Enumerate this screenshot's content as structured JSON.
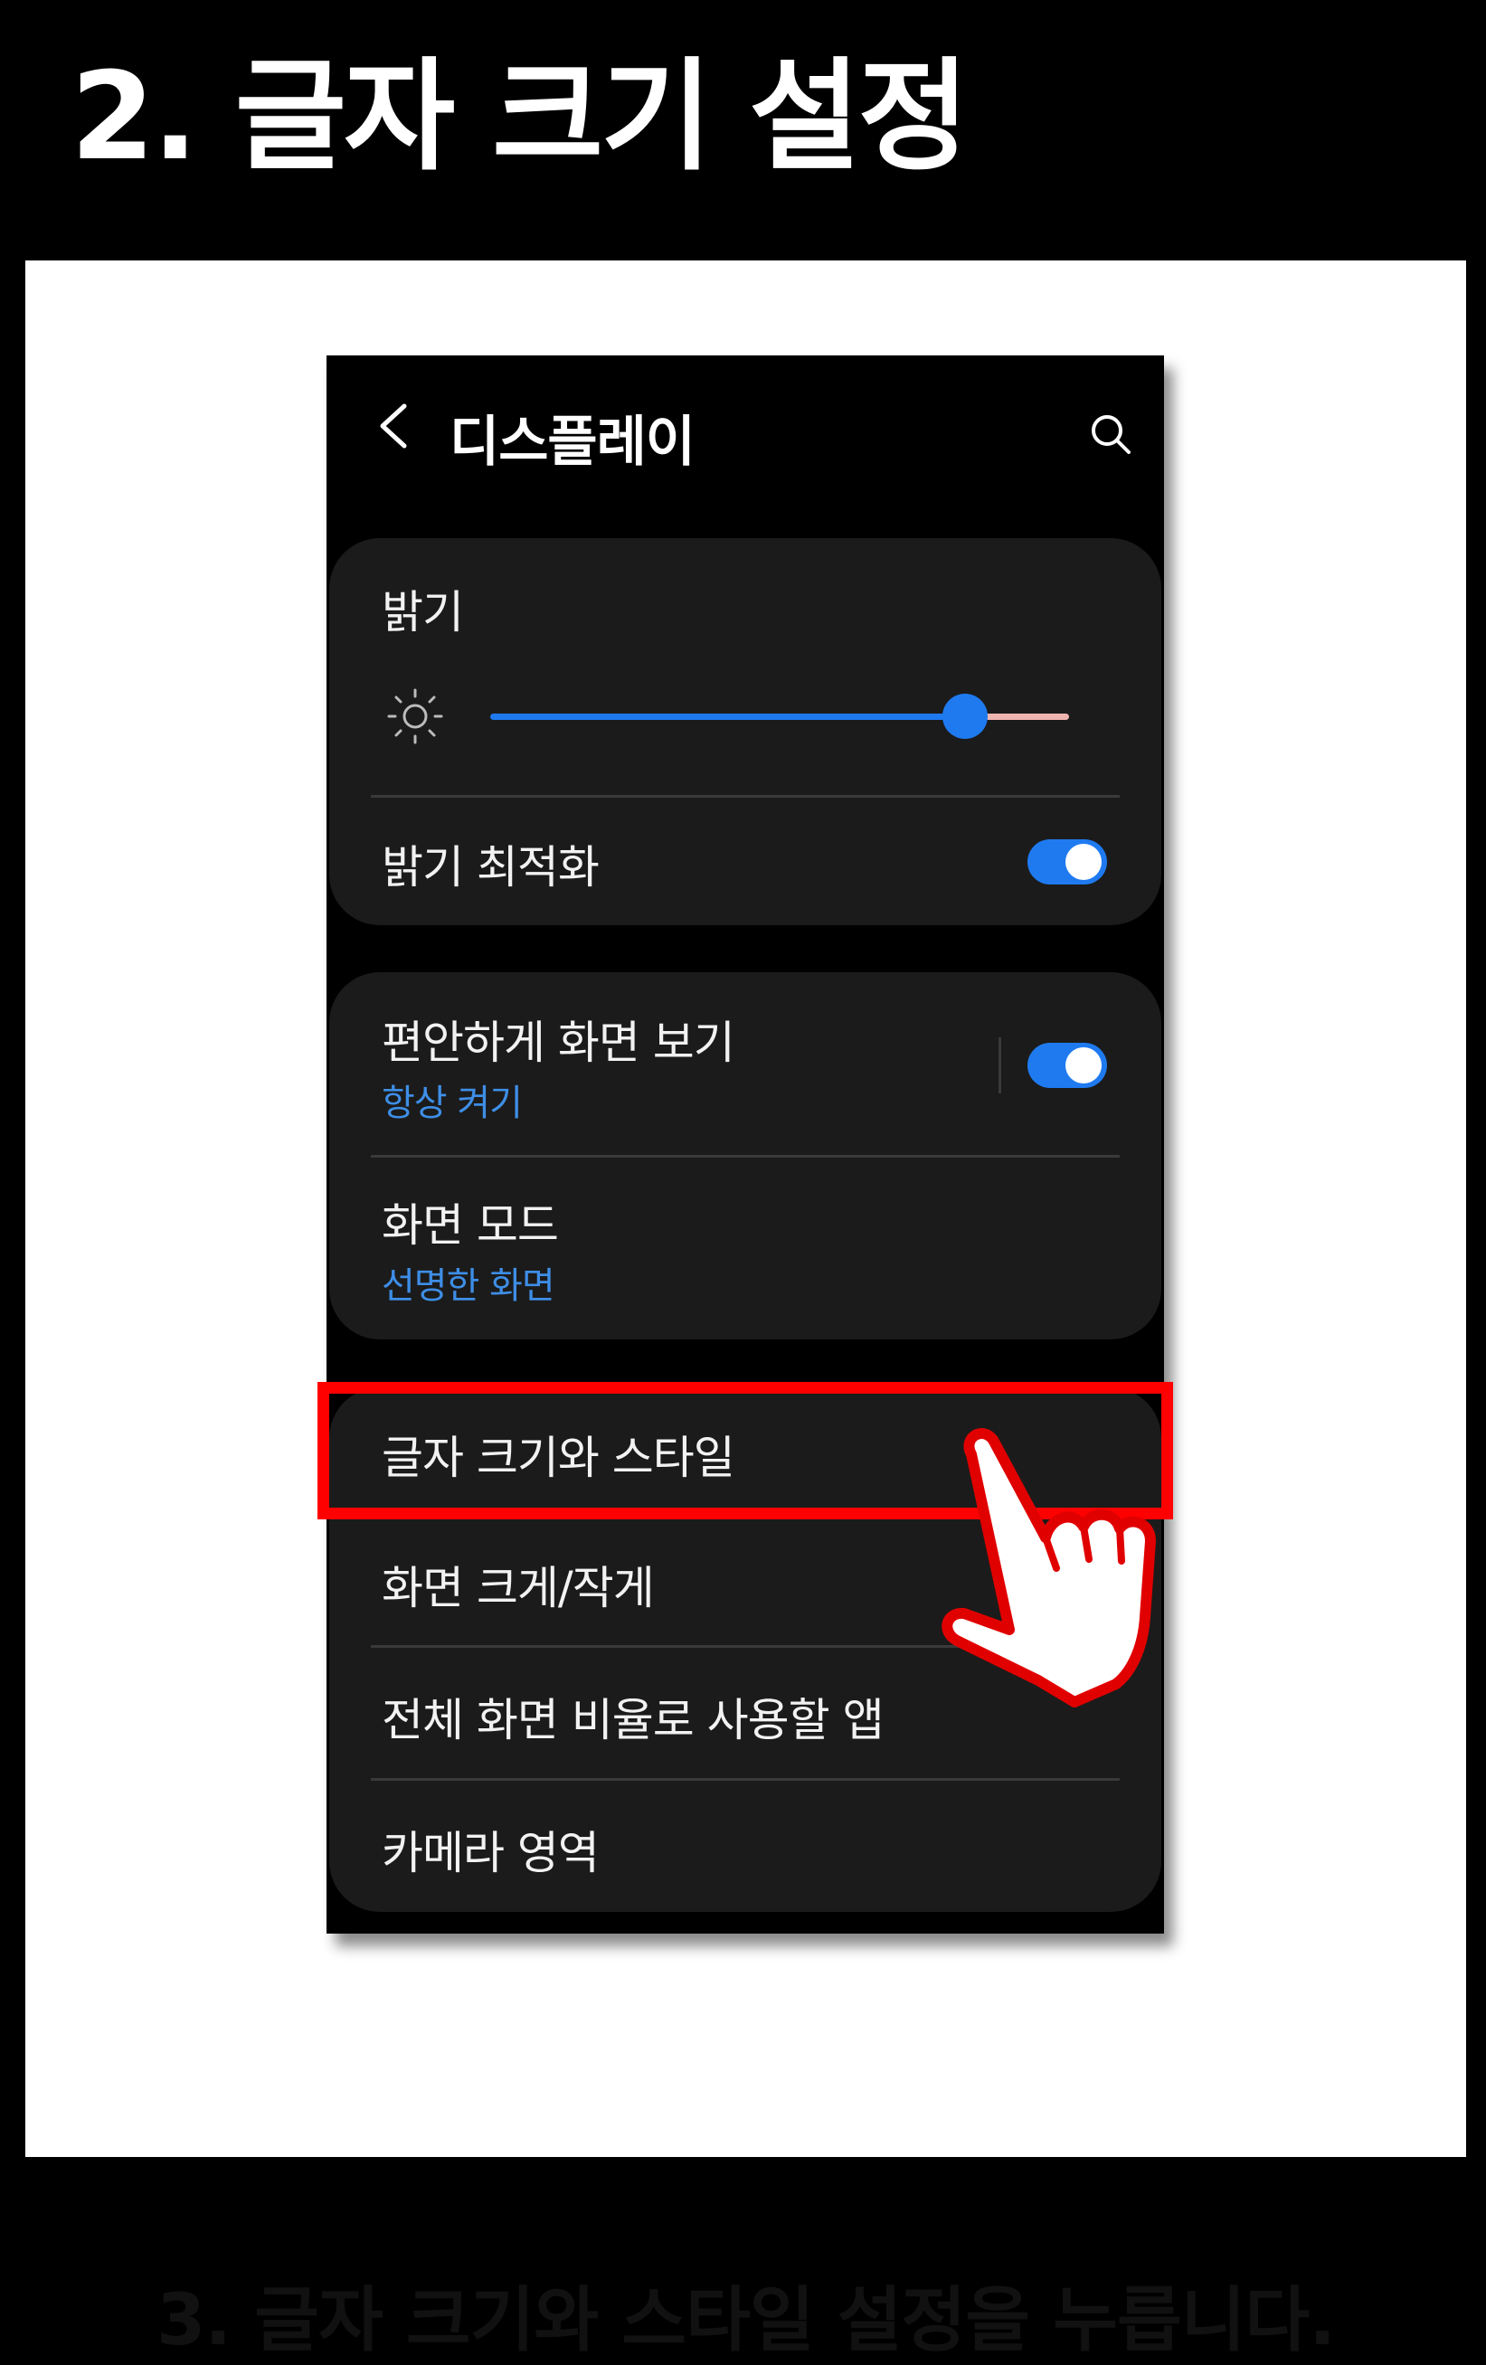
{
  "heading": "2. 글자 크기 설정",
  "screen": {
    "title": "디스플레이",
    "brightness": {
      "label": "밝기",
      "level_percent": 82
    },
    "adaptive_brightness": {
      "label": "밝기 최적화",
      "enabled": true
    },
    "eye_comfort": {
      "label": "편안하게 화면 보기",
      "status": "항상 켜기",
      "enabled": true
    },
    "screen_mode": {
      "label": "화면 모드",
      "value": "선명한 화면"
    },
    "menu_items": [
      {
        "label": "글자 크기와 스타일"
      },
      {
        "label": "화면 크게/작게"
      },
      {
        "label": "전체 화면 비율로 사용할 앱"
      },
      {
        "label": "카메라 영역"
      }
    ]
  },
  "caption": "3. 글자 크기와 스타일 설정을 누릅니다.",
  "colors": {
    "accent_blue": "#1f7af0",
    "sub_text_blue": "#3e8ee6",
    "highlight_red": "#ff0000",
    "card_bg": "#1b1b1b"
  },
  "icons": [
    "back-arrow-icon",
    "search-icon",
    "sun-icon",
    "tap-hand-icon"
  ]
}
